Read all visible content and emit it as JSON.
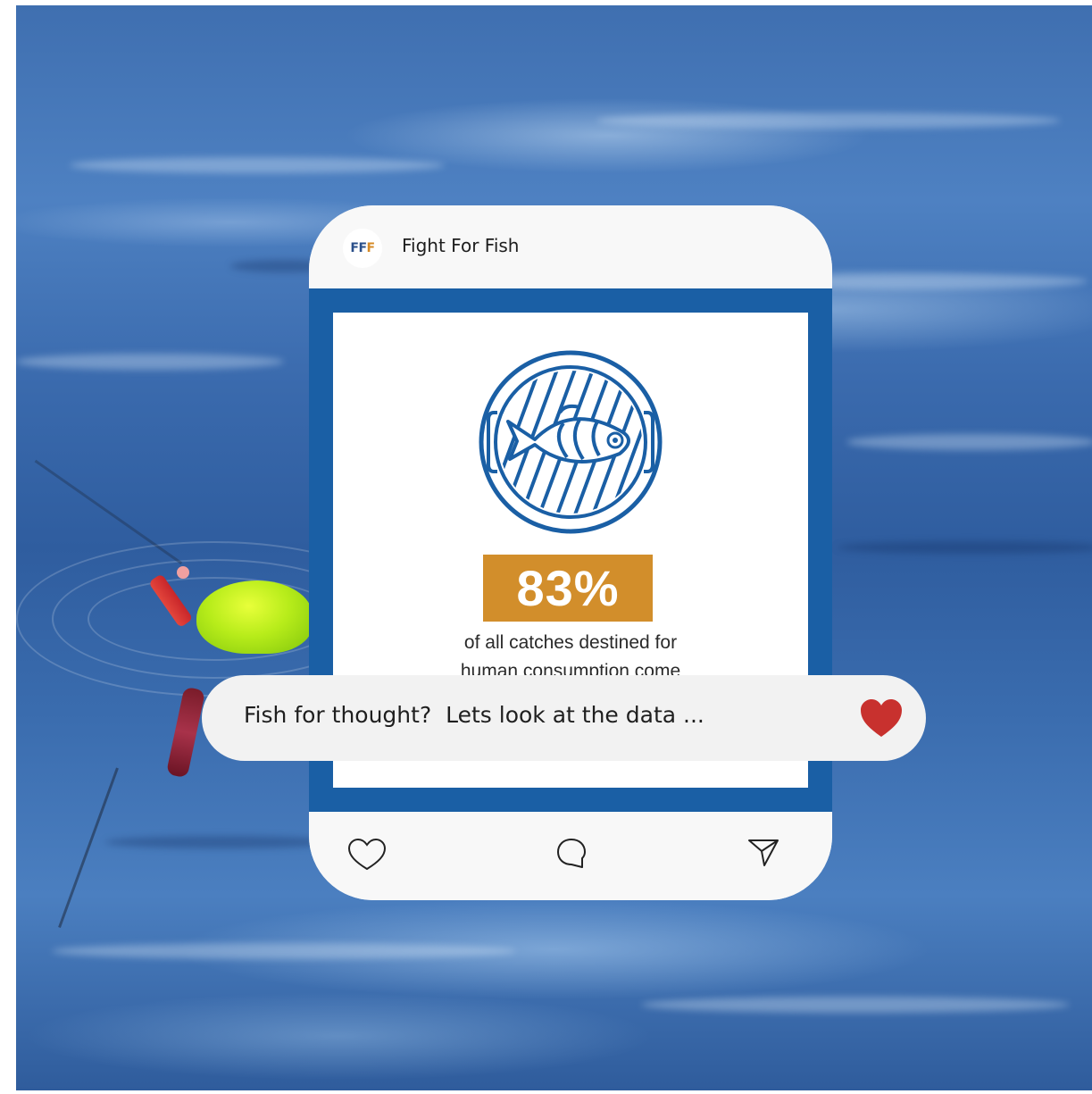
{
  "post": {
    "account_name": "Fight For Fish",
    "avatar_text": [
      "F",
      "F",
      "F"
    ],
    "image": {
      "stat_value": "83%",
      "stat_description_line1": "of all catches destined for",
      "stat_description_line2": "human consumption come"
    },
    "caption": "Fish for thought?  Lets look at the data ..."
  },
  "actions": {
    "like_icon": "heart-outline-icon",
    "comment_icon": "speech-bubble-icon",
    "share_icon": "paper-plane-icon"
  },
  "colors": {
    "frame_blue": "#1a5fa5",
    "stat_orange": "#d28e2b",
    "heart_red": "#c8312e",
    "card_bg": "#f8f8f8"
  }
}
